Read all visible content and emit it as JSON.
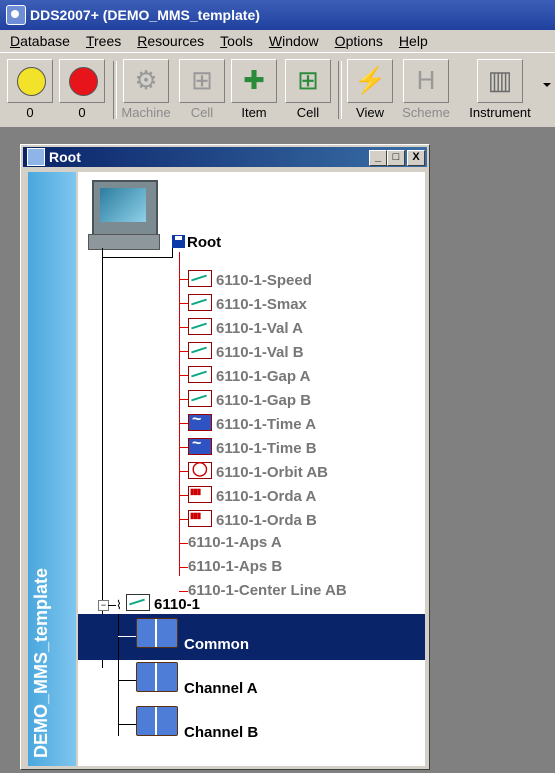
{
  "window": {
    "title": "DDS2007+ (DEMO_MMS_template)"
  },
  "menu": [
    {
      "label": "Database",
      "mnemonic": "D",
      "rest": "atabase"
    },
    {
      "label": "Trees",
      "mnemonic": "T",
      "rest": "rees"
    },
    {
      "label": "Resources",
      "mnemonic": "R",
      "rest": "esources"
    },
    {
      "label": "Tools",
      "mnemonic": "T",
      "rest": "ools"
    },
    {
      "label": "Window",
      "mnemonic": "W",
      "rest": "indow"
    },
    {
      "label": "Options",
      "mnemonic": "O",
      "rest": "ptions"
    },
    {
      "label": "Help",
      "mnemonic": "H",
      "rest": "elp"
    }
  ],
  "toolbar": {
    "buttons": [
      {
        "label": "0",
        "icon": "yellow-circle-icon",
        "enabled": true
      },
      {
        "label": "0",
        "icon": "red-circle-icon",
        "enabled": true
      },
      {
        "label": "Machine",
        "icon": "machine-icon",
        "enabled": false
      },
      {
        "label": "Cell",
        "icon": "cell-icon",
        "enabled": false
      },
      {
        "label": "Item",
        "icon": "item-icon",
        "enabled": true
      },
      {
        "label": "Cell",
        "icon": "cell-add-icon",
        "enabled": true
      },
      {
        "label": "View",
        "icon": "view-icon",
        "enabled": true
      },
      {
        "label": "Scheme",
        "icon": "scheme-icon",
        "enabled": false
      },
      {
        "label": "Instrument",
        "icon": "instrument-icon",
        "enabled": true
      }
    ],
    "colors": {
      "yellow": "#f2e22a",
      "red": "#e8141b"
    }
  },
  "child_window": {
    "title": "Root",
    "buttons": {
      "minimize": "_",
      "restore": "□",
      "close": "X"
    },
    "side_panel": {
      "text": "DEMO_MMS_template",
      "color": "#4aa7dd"
    }
  },
  "tree": {
    "root_label": "Root",
    "points": [
      {
        "label": "6110-1-Speed",
        "icon": "trend"
      },
      {
        "label": "6110-1-Smax",
        "icon": "trend"
      },
      {
        "label": "6110-1-Val A",
        "icon": "trend"
      },
      {
        "label": "6110-1-Val B",
        "icon": "trend"
      },
      {
        "label": "6110-1-Gap A",
        "icon": "trend"
      },
      {
        "label": "6110-1-Gap B",
        "icon": "trend"
      },
      {
        "label": "6110-1-Time A",
        "icon": "time"
      },
      {
        "label": "6110-1-Time B",
        "icon": "time"
      },
      {
        "label": "6110-1-Orbit AB",
        "icon": "orbit"
      },
      {
        "label": "6110-1-Orda A",
        "icon": "orda"
      },
      {
        "label": "6110-1-Orda B",
        "icon": "orda"
      },
      {
        "label": "6110-1-Aps A",
        "icon": "none"
      },
      {
        "label": "6110-1-Aps B",
        "icon": "none"
      },
      {
        "label": "6110-1-Center Line AB",
        "icon": "none"
      }
    ],
    "machine_label": "6110-1",
    "groups": [
      {
        "label": "Common",
        "selected": true
      },
      {
        "label": "Channel A",
        "selected": false
      },
      {
        "label": "Channel B",
        "selected": false
      }
    ],
    "line_color": "#d00000",
    "selection_color": "#0a246a"
  }
}
